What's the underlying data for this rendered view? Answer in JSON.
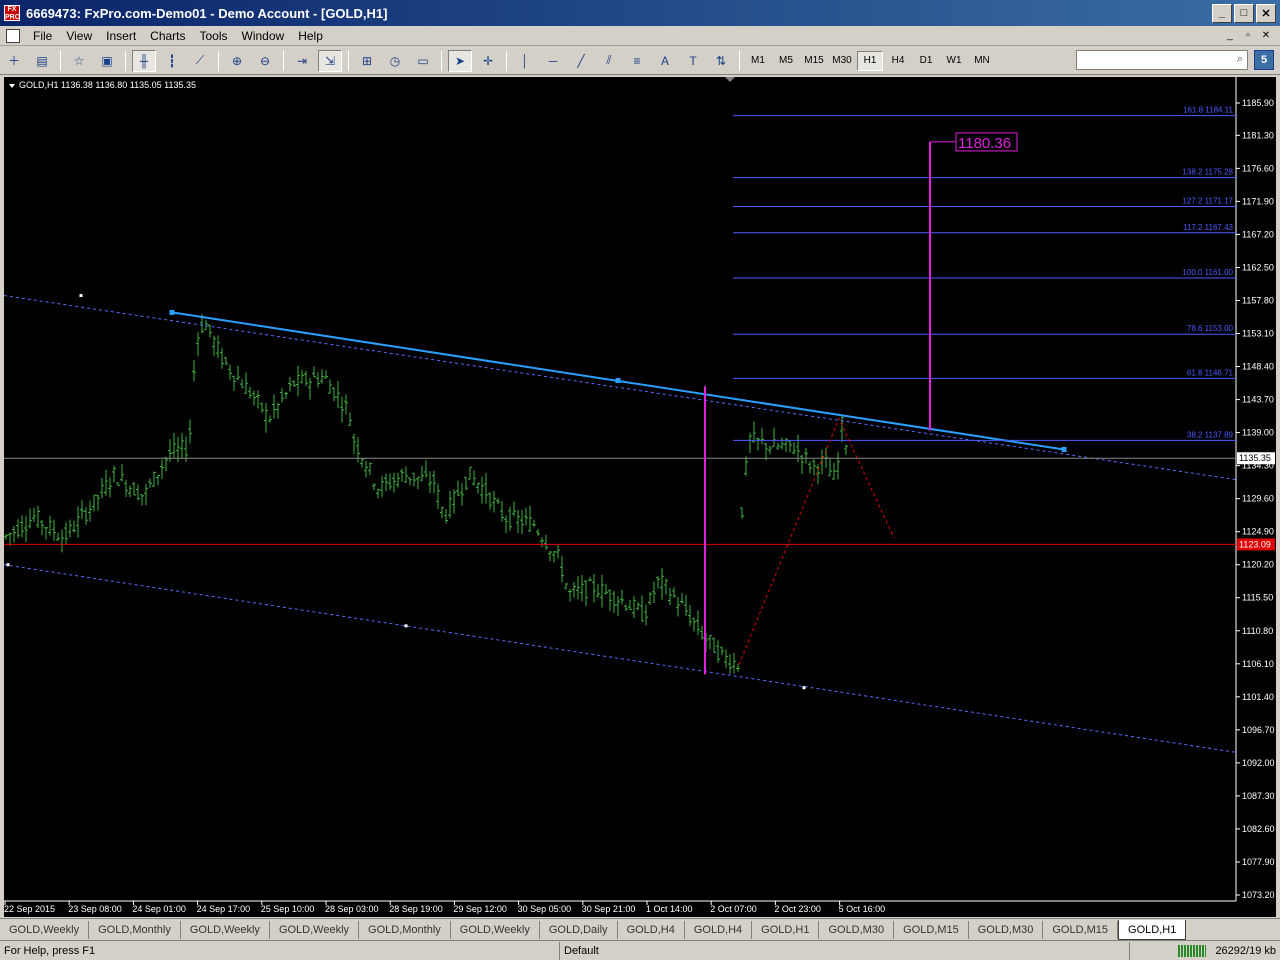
{
  "window": {
    "title": "6669473: FxPro.com-Demo01 - Demo Account - [GOLD,H1]",
    "app_icon_text": "FX PRO",
    "min_glyph": "_",
    "max_glyph": "□",
    "close_glyph": "✕"
  },
  "menu": {
    "items": [
      "File",
      "View",
      "Insert",
      "Charts",
      "Tools",
      "Window",
      "Help"
    ],
    "mdi_glyphs": [
      "_",
      "▫",
      "✕"
    ]
  },
  "toolbar": {
    "timeframes": [
      "M1",
      "M5",
      "M15",
      "M30",
      "H1",
      "H4",
      "D1",
      "W1",
      "MN"
    ],
    "active_timeframe": "H1",
    "search_placeholder": "",
    "bigfont_glyph": "5"
  },
  "chart": {
    "info": "GOLD,H1  1136.38 1136.80 1135.05 1135.35",
    "colors": {
      "background": "#000000",
      "candle": "#3fb33f",
      "trendline": "#2aa0ff",
      "channel": "#5a6cff",
      "fibo": "#4a5cff",
      "horizontal": "#e00000",
      "magenta": "#e020e0",
      "grid_text": "#ffffff"
    },
    "price_axis": [
      "1185.90",
      "1181.30",
      "1176.60",
      "1171.90",
      "1167.20",
      "1162.50",
      "1157.80",
      "1153.10",
      "1148.40",
      "1143.70",
      "1139.00",
      "1134.30",
      "1129.60",
      "1124.90",
      "1120.20",
      "1115.50",
      "1110.80",
      "1106.10",
      "1101.40",
      "1096.70",
      "1092.00",
      "1087.30",
      "1082.60",
      "1077.90",
      "1073.20"
    ],
    "price_range": [
      1073.2,
      1185.9
    ],
    "current_price_label": "1135.35",
    "current_price": 1135.35,
    "red_line_price": 1123.09,
    "red_line_label": "1123.09",
    "time_axis": [
      "22 Sep 2015",
      "23 Sep 08:00",
      "24 Sep 01:00",
      "24 Sep 17:00",
      "25 Sep 10:00",
      "28 Sep 03:00",
      "28 Sep 19:00",
      "29 Sep 12:00",
      "30 Sep 05:00",
      "30 Sep 21:00",
      "1 Oct 14:00",
      "2 Oct 07:00",
      "2 Oct 23:00",
      "5 Oct 16:00"
    ],
    "fibo_levels": [
      {
        "label": "161.8  1184.11",
        "price": 1184.11
      },
      {
        "label": "138.2  1175.28",
        "price": 1175.28
      },
      {
        "label": "127.2  1171.17",
        "price": 1171.17
      },
      {
        "label": "117.2  1167.43",
        "price": 1167.43
      },
      {
        "label": "100.0    1161.00",
        "price": 1161.0
      },
      {
        "label": "78.6  1153.00",
        "price": 1153.0
      },
      {
        "label": "61.8  1146.71",
        "price": 1146.71
      },
      {
        "label": "38.2  1137.89",
        "price": 1137.89
      }
    ],
    "target_label": "1180.36",
    "target_price": 1180.36
  },
  "tabs": {
    "items": [
      "GOLD,Weekly",
      "GOLD,Monthly",
      "GOLD,Weekly",
      "GOLD,Weekly",
      "GOLD,Monthly",
      "GOLD,Weekly",
      "GOLD,Daily",
      "GOLD,H4",
      "GOLD,H4",
      "GOLD,H1",
      "GOLD,M30",
      "GOLD,M15",
      "GOLD,M30",
      "GOLD,M15",
      "GOLD,H1"
    ],
    "active_index": 14
  },
  "status": {
    "help": "For Help, press F1",
    "profile": "Default",
    "traffic": "26292/19 kb"
  }
}
